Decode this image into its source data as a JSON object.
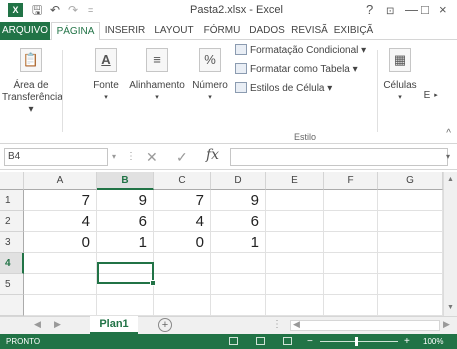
{
  "window": {
    "title": "Pasta2.xlsx - Excel",
    "help": "?",
    "minimize": "—",
    "restore": "□",
    "close": "×"
  },
  "quick_access": {
    "logo": "X",
    "save": "🖫",
    "undo": "↶",
    "redo": "↷",
    "customize": "="
  },
  "tabs": [
    "ARQUIVO",
    "PÁGINA",
    "INSERIR",
    "LAYOUT",
    "FÓRMU",
    "DADOS",
    "REVISÃ",
    "EXIBIÇÃ"
  ],
  "ribbon": {
    "clipboard": {
      "label1": "Área de",
      "label2": "Transferência ▾"
    },
    "font": {
      "label": "Fonte",
      "arrow": "▾"
    },
    "alignment": {
      "label": "Alinhamento",
      "arrow": "▾"
    },
    "number": {
      "label": "Número",
      "arrow": "▾"
    },
    "styles": {
      "conditional": "Formatação Condicional ▾",
      "as_table": "Formatar como Tabela ▾",
      "cell_styles": "Estilos de Célula ▾",
      "group_label": "Estilo"
    },
    "cells": {
      "label": "Células",
      "arrow": "▾"
    },
    "editing": {
      "label": "E"
    },
    "collapse": "^"
  },
  "formula_bar": {
    "name_box": "B4",
    "fx": "fx",
    "value": ""
  },
  "grid": {
    "columns": [
      "A",
      "B",
      "C",
      "D",
      "E",
      "F",
      "G"
    ],
    "rows": [
      "1",
      "2",
      "3",
      "4",
      "5"
    ],
    "cells": [
      [
        "7",
        "9",
        "7",
        "9"
      ],
      [
        "4",
        "6",
        "4",
        "6"
      ],
      [
        "0",
        "1",
        "0",
        "1"
      ]
    ],
    "selected_column": "B",
    "selected_row": "4"
  },
  "sheets": {
    "active": "Plan1",
    "add": "+"
  },
  "status": {
    "ready": "PRONTO",
    "zoom_minus": "−",
    "zoom_plus": "+",
    "zoom": "100%"
  },
  "colors": {
    "accent": "#217346"
  }
}
